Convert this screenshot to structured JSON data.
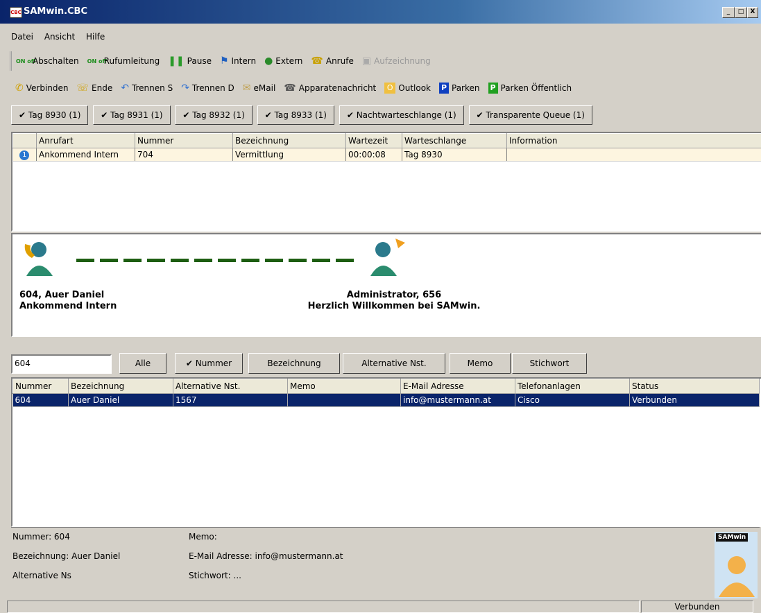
{
  "window": {
    "title": "SAMwin.CBC",
    "min": "_",
    "max": "□",
    "close": "X"
  },
  "menu": [
    "Datei",
    "Ansicht",
    "Hilfe"
  ],
  "toolbar1": [
    {
      "label": "Abschalten",
      "icon": "on-off-icon"
    },
    {
      "label": "Rufumleitung",
      "icon": "on-off-icon"
    },
    {
      "label": "Pause",
      "icon": "pause-icon"
    },
    {
      "label": "Intern",
      "icon": "intern-icon"
    },
    {
      "label": "Extern",
      "icon": "globe-icon"
    },
    {
      "label": "Anrufe",
      "icon": "calls-icon"
    },
    {
      "label": "Aufzeichnung",
      "icon": "record-icon",
      "disabled": true
    }
  ],
  "on_off_text": "ON off",
  "toolbar2": [
    {
      "label": "Verbinden",
      "icon": "phone-connect-icon"
    },
    {
      "label": "Ende",
      "icon": "phone-hangup-icon"
    },
    {
      "label": "Trennen S",
      "icon": "split-icon"
    },
    {
      "label": "Trennen D",
      "icon": "split-icon"
    },
    {
      "label": "eMail",
      "icon": "envelope-icon"
    },
    {
      "label": "Apparatenachricht",
      "icon": "phone-message-icon"
    },
    {
      "label": "Outlook",
      "icon": "outlook-icon"
    },
    {
      "label": "Parken",
      "icon": "parking-icon"
    },
    {
      "label": "Parken Öffentlich",
      "icon": "parking-public-icon"
    }
  ],
  "filter_tabs": [
    "Tag 8930 (1)",
    "Tag 8931 (1)",
    "Tag 8932 (1)",
    "Tag 8933 (1)",
    "Nachtwarteschlange (1)",
    "Transparente Queue (1)"
  ],
  "check_mark": "✔",
  "queue": {
    "columns": [
      "",
      "Anrufart",
      "Nummer",
      "Bezeichnung",
      "Wartezeit",
      "Warteschlange",
      "Information"
    ],
    "rows": [
      [
        "1",
        "Ankommend Intern",
        "704",
        "Vermittlung",
        "00:00:08",
        "Tag 8930",
        ""
      ]
    ]
  },
  "call": {
    "left_line1": "604, Auer Daniel",
    "left_line2": "Ankommend Intern",
    "right_line1": "Administrator, 656",
    "right_line2": "Herzlich Willkommen bei SAMwin."
  },
  "search": {
    "value": "604",
    "buttons": [
      "Alle",
      "Nummer",
      "Bezeichnung",
      "Alternative Nst.",
      "Memo",
      "Stichwort"
    ]
  },
  "directory": {
    "columns": [
      "Nummer",
      "Bezeichnung",
      "Alternative Nst.",
      "Memo",
      "E-Mail Adresse",
      "Telefonanlagen",
      "Status"
    ],
    "rows": [
      [
        "604",
        "Auer Daniel",
        "1567",
        "",
        "info@mustermann.at",
        "Cisco",
        "Verbunden"
      ]
    ]
  },
  "details": {
    "nummer": "Nummer: 604",
    "bezeichnung": "Bezeichnung: Auer Daniel",
    "alternative": "Alternative Ns",
    "memo": "Memo:",
    "email": "E-Mail Adresse: info@mustermann.at",
    "stichwort": "Stichwort: ..."
  },
  "logo": "SAMwin",
  "status": {
    "right": "Verbunden"
  },
  "colors": {
    "title_start": "#0a246a",
    "selection": "#0a246a",
    "line_green": "#1d5e12"
  }
}
